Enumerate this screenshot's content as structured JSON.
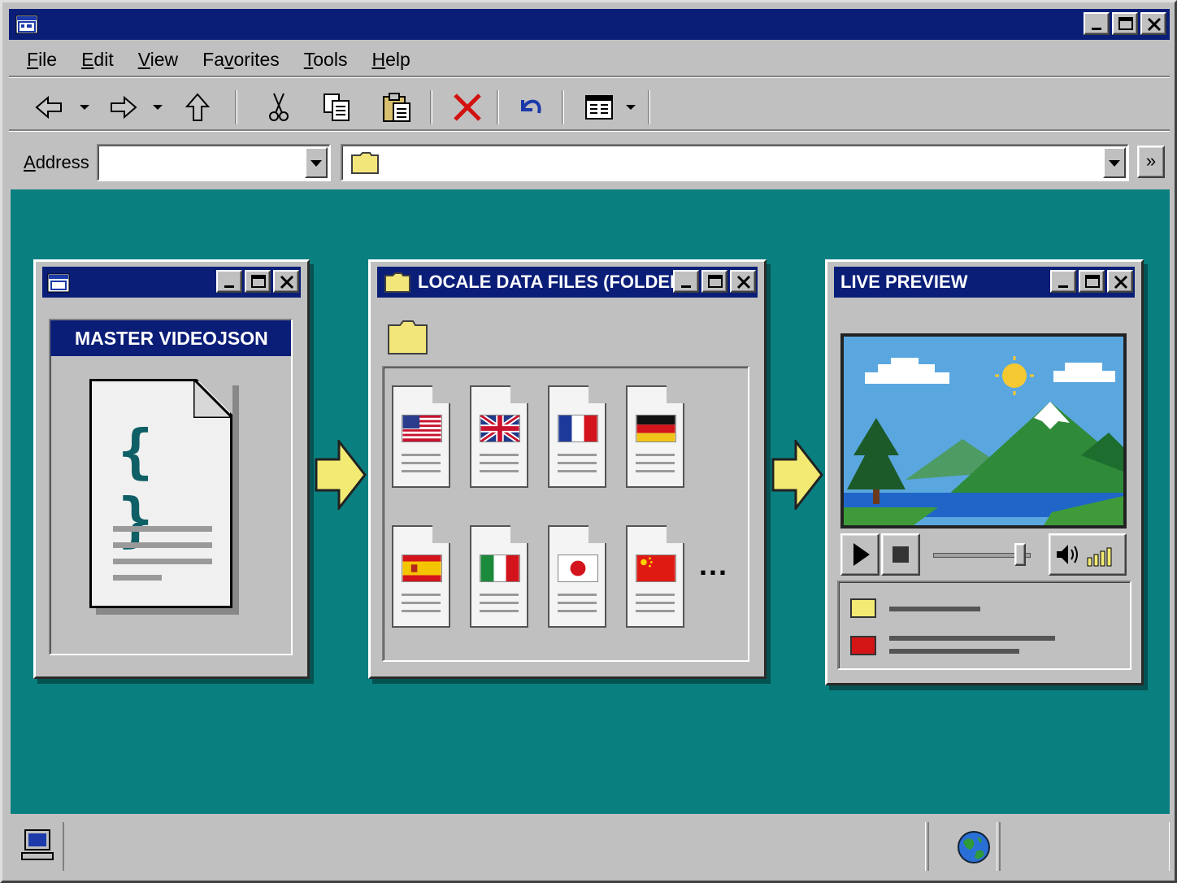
{
  "window": {
    "title": "",
    "app_icon": "explorer-window-icon",
    "controls": [
      "minimize-icon",
      "maximize-icon",
      "close-icon"
    ]
  },
  "menu": {
    "items": [
      "File",
      "Edit",
      "View",
      "Favorites",
      "Tools",
      "Help"
    ]
  },
  "toolbar": {
    "buttons": [
      "back-arrow-icon",
      "forward-arrow-icon",
      "up-arrow-icon",
      "cut-icon",
      "copy-icon",
      "paste-icon",
      "delete-icon",
      "undo-icon",
      "views-icon"
    ]
  },
  "address": {
    "label": "Address",
    "left_value": "",
    "path_value": "",
    "go_label": "»"
  },
  "panels": {
    "master": {
      "title": "",
      "heading": "MASTER VIDEOJSON",
      "braces": "{ }"
    },
    "locale": {
      "title": "LOCALE DATA FILES (FOLDER)",
      "flags": [
        "usa-flag",
        "uk-flag",
        "france-flag",
        "germany-flag",
        "spain-flag",
        "italy-flag",
        "japan-flag",
        "china-flag"
      ],
      "more": "..."
    },
    "preview": {
      "title": "LIVE PREVIEW",
      "legend_colors": [
        "#f2ea73",
        "#d41515"
      ]
    }
  },
  "colors": {
    "titlebar": "#0a1e78",
    "desktop": "#097f80",
    "arrow": "#f2ea73"
  },
  "statusbar": {
    "left_icon": "computer-icon",
    "right_icon": "globe-icon"
  }
}
